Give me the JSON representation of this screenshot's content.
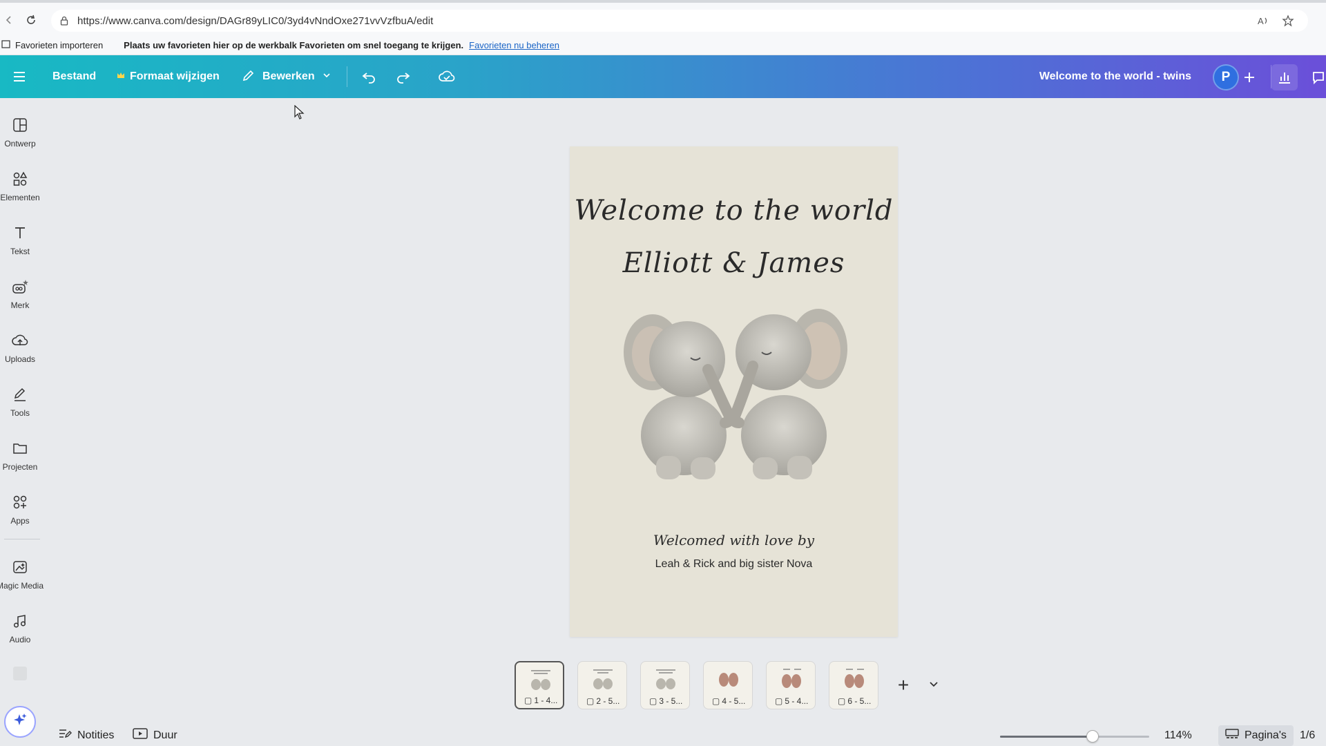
{
  "browser": {
    "url": "https://www.canva.com/design/DAGr89yLIC0/3yd4vNndOxe271vvVzfbuA/edit",
    "favorites_import": "Favorieten importeren",
    "favorites_message": "Plaats uw favorieten hier op de werkbalk Favorieten om snel toegang te krijgen.",
    "favorites_link": "Favorieten nu beheren"
  },
  "topbar": {
    "file_label": "Bestand",
    "resize_label": "Formaat wijzigen",
    "edit_label": "Bewerken",
    "design_title": "Welcome to the world - twins",
    "avatar_letter": "P"
  },
  "sidebar": {
    "items": [
      {
        "label": "Ontwerp",
        "icon": "layout-icon"
      },
      {
        "label": "Elementen",
        "icon": "shapes-icon"
      },
      {
        "label": "Tekst",
        "icon": "text-icon"
      },
      {
        "label": "Merk",
        "icon": "brand-icon"
      },
      {
        "label": "Uploads",
        "icon": "cloud-upload-icon"
      },
      {
        "label": "Tools",
        "icon": "pen-icon"
      },
      {
        "label": "Projecten",
        "icon": "folder-icon"
      },
      {
        "label": "Apps",
        "icon": "apps-icon"
      },
      {
        "label": "Magic Media",
        "icon": "magic-media-icon"
      },
      {
        "label": "Audio",
        "icon": "music-icon"
      }
    ]
  },
  "canvas": {
    "headline_line1": "Welcome to the world",
    "headline_line2": "Elliott & James",
    "welcomed_by": "Welcomed with love by",
    "family_names": "Leah & Rick and big sister Nova"
  },
  "thumbnails": [
    {
      "label": "1 - 4...",
      "active": true
    },
    {
      "label": "2 - 5...",
      "active": false
    },
    {
      "label": "3 - 5...",
      "active": false
    },
    {
      "label": "4 - 5...",
      "active": false
    },
    {
      "label": "5 - 4...",
      "active": false
    },
    {
      "label": "6 - 5...",
      "active": false
    }
  ],
  "bottombar": {
    "notes_label": "Notities",
    "duration_label": "Duur",
    "zoom_level": "114%",
    "zoom_fraction": 0.62,
    "pages_label": "Pagina's",
    "page_count": "1/6"
  },
  "colors": {
    "topbar_start": "#18b9c4",
    "topbar_end": "#6b4fd9",
    "page_background": "#e6e3d7",
    "avatar": "#2f6fe0"
  }
}
